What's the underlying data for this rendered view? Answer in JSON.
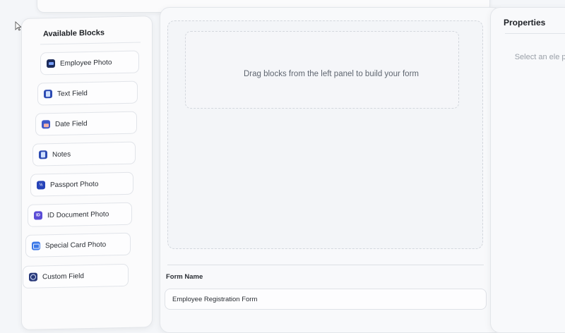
{
  "left_panel": {
    "title": "Available Blocks",
    "blocks": [
      {
        "label": "Employee Photo",
        "icon": "employee-photo-icon"
      },
      {
        "label": "Text Field",
        "icon": "text-field-icon"
      },
      {
        "label": "Date Field",
        "icon": "date-field-icon"
      },
      {
        "label": "Notes",
        "icon": "notes-icon"
      },
      {
        "label": "Passport Photo",
        "icon": "passport-photo-icon"
      },
      {
        "label": "ID Document Photo",
        "icon": "id-document-photo-icon"
      },
      {
        "label": "Special Card Photo",
        "icon": "special-card-photo-icon"
      },
      {
        "label": "Custom Field",
        "icon": "custom-field-icon"
      }
    ]
  },
  "canvas": {
    "drop_hint": "Drag blocks from the left panel to build your form",
    "form_name_label": "Form Name",
    "form_name_value": "Employee Registration Form"
  },
  "right_panel": {
    "title": "Properties",
    "placeholder": "Select an ele pro"
  }
}
